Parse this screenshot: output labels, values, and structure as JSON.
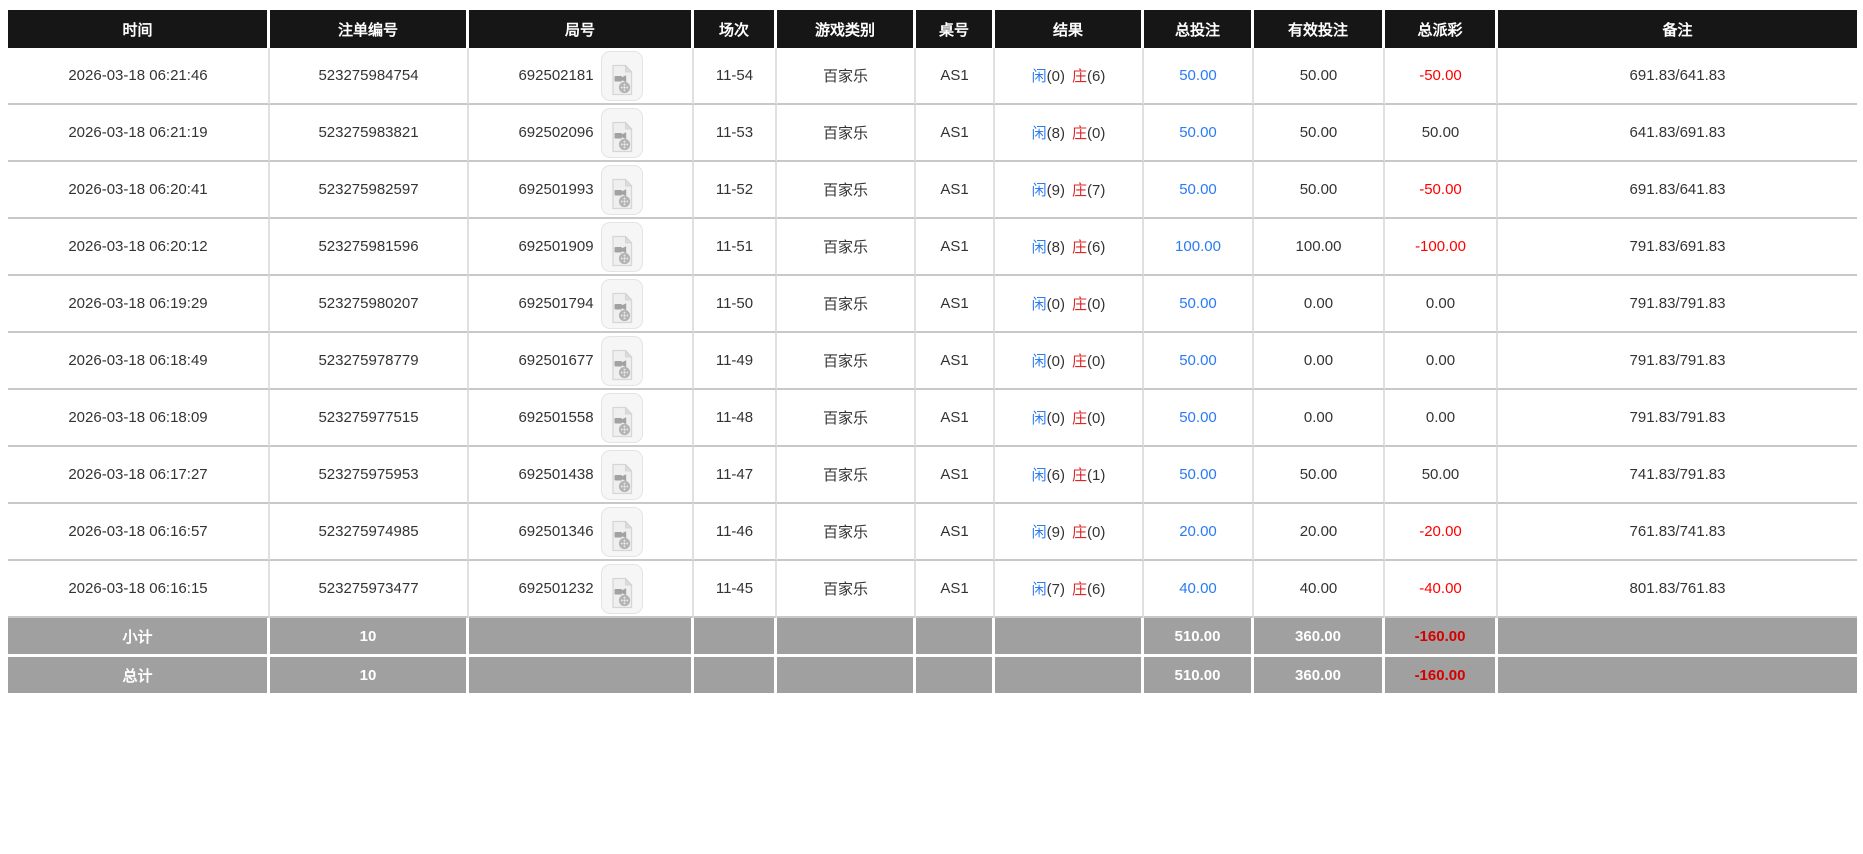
{
  "columns": [
    {
      "label": "时间"
    },
    {
      "label": "注单编号"
    },
    {
      "label": "局号"
    },
    {
      "label": "场次"
    },
    {
      "label": "游戏类别"
    },
    {
      "label": "桌号"
    },
    {
      "label": "结果"
    },
    {
      "label": "总投注"
    },
    {
      "label": "有效投注"
    },
    {
      "label": "总派彩"
    },
    {
      "label": "备注"
    }
  ],
  "rows": [
    {
      "time": "2026-03-18 06:21:46",
      "bet_no": "523275984754",
      "round_no": "692502181",
      "session": "11-54",
      "game_type": "百家乐",
      "table_no": "AS1",
      "result": {
        "player_label": "闲",
        "player_value": "(0)",
        "banker_label": "庄",
        "banker_value": "(6)"
      },
      "total_bet": "50.00",
      "valid_bet": "50.00",
      "payout": "-50.00",
      "remark": "691.83/641.83"
    },
    {
      "time": "2026-03-18 06:21:19",
      "bet_no": "523275983821",
      "round_no": "692502096",
      "session": "11-53",
      "game_type": "百家乐",
      "table_no": "AS1",
      "result": {
        "player_label": "闲",
        "player_value": "(8)",
        "banker_label": "庄",
        "banker_value": "(0)"
      },
      "total_bet": "50.00",
      "valid_bet": "50.00",
      "payout": "50.00",
      "remark": "641.83/691.83"
    },
    {
      "time": "2026-03-18 06:20:41",
      "bet_no": "523275982597",
      "round_no": "692501993",
      "session": "11-52",
      "game_type": "百家乐",
      "table_no": "AS1",
      "result": {
        "player_label": "闲",
        "player_value": "(9)",
        "banker_label": "庄",
        "banker_value": "(7)"
      },
      "total_bet": "50.00",
      "valid_bet": "50.00",
      "payout": "-50.00",
      "remark": "691.83/641.83"
    },
    {
      "time": "2026-03-18 06:20:12",
      "bet_no": "523275981596",
      "round_no": "692501909",
      "session": "11-51",
      "game_type": "百家乐",
      "table_no": "AS1",
      "result": {
        "player_label": "闲",
        "player_value": "(8)",
        "banker_label": "庄",
        "banker_value": "(6)"
      },
      "total_bet": "100.00",
      "valid_bet": "100.00",
      "payout": "-100.00",
      "remark": "791.83/691.83"
    },
    {
      "time": "2026-03-18 06:19:29",
      "bet_no": "523275980207",
      "round_no": "692501794",
      "session": "11-50",
      "game_type": "百家乐",
      "table_no": "AS1",
      "result": {
        "player_label": "闲",
        "player_value": "(0)",
        "banker_label": "庄",
        "banker_value": "(0)"
      },
      "total_bet": "50.00",
      "valid_bet": "0.00",
      "payout": "0.00",
      "remark": "791.83/791.83"
    },
    {
      "time": "2026-03-18 06:18:49",
      "bet_no": "523275978779",
      "round_no": "692501677",
      "session": "11-49",
      "game_type": "百家乐",
      "table_no": "AS1",
      "result": {
        "player_label": "闲",
        "player_value": "(0)",
        "banker_label": "庄",
        "banker_value": "(0)"
      },
      "total_bet": "50.00",
      "valid_bet": "0.00",
      "payout": "0.00",
      "remark": "791.83/791.83"
    },
    {
      "time": "2026-03-18 06:18:09",
      "bet_no": "523275977515",
      "round_no": "692501558",
      "session": "11-48",
      "game_type": "百家乐",
      "table_no": "AS1",
      "result": {
        "player_label": "闲",
        "player_value": "(0)",
        "banker_label": "庄",
        "banker_value": "(0)"
      },
      "total_bet": "50.00",
      "valid_bet": "0.00",
      "payout": "0.00",
      "remark": "791.83/791.83"
    },
    {
      "time": "2026-03-18 06:17:27",
      "bet_no": "523275975953",
      "round_no": "692501438",
      "session": "11-47",
      "game_type": "百家乐",
      "table_no": "AS1",
      "result": {
        "player_label": "闲",
        "player_value": "(6)",
        "banker_label": "庄",
        "banker_value": "(1)"
      },
      "total_bet": "50.00",
      "valid_bet": "50.00",
      "payout": "50.00",
      "remark": "741.83/791.83"
    },
    {
      "time": "2026-03-18 06:16:57",
      "bet_no": "523275974985",
      "round_no": "692501346",
      "session": "11-46",
      "game_type": "百家乐",
      "table_no": "AS1",
      "result": {
        "player_label": "闲",
        "player_value": "(9)",
        "banker_label": "庄",
        "banker_value": "(0)"
      },
      "total_bet": "20.00",
      "valid_bet": "20.00",
      "payout": "-20.00",
      "remark": "761.83/741.83"
    },
    {
      "time": "2026-03-18 06:16:15",
      "bet_no": "523275973477",
      "round_no": "692501232",
      "session": "11-45",
      "game_type": "百家乐",
      "table_no": "AS1",
      "result": {
        "player_label": "闲",
        "player_value": "(7)",
        "banker_label": "庄",
        "banker_value": "(6)"
      },
      "total_bet": "40.00",
      "valid_bet": "40.00",
      "payout": "-40.00",
      "remark": "801.83/761.83"
    }
  ],
  "footer": {
    "subtotal": {
      "label": "小计",
      "count": "10",
      "total_bet": "510.00",
      "valid_bet": "360.00",
      "payout": "-160.00"
    },
    "total": {
      "label": "总计",
      "count": "10",
      "total_bet": "510.00",
      "valid_bet": "360.00",
      "payout": "-160.00"
    }
  },
  "icons": {
    "round_video": "video-file-icon"
  },
  "colors": {
    "header_bg": "#161616",
    "bet_blue": "#2b7bf3",
    "player_blue": "#2b7bf3",
    "banker_red": "#e02525",
    "negative_red": "#ff0000",
    "footer_bg": "#a0a0a0",
    "footer_negative_red": "#d60000"
  }
}
